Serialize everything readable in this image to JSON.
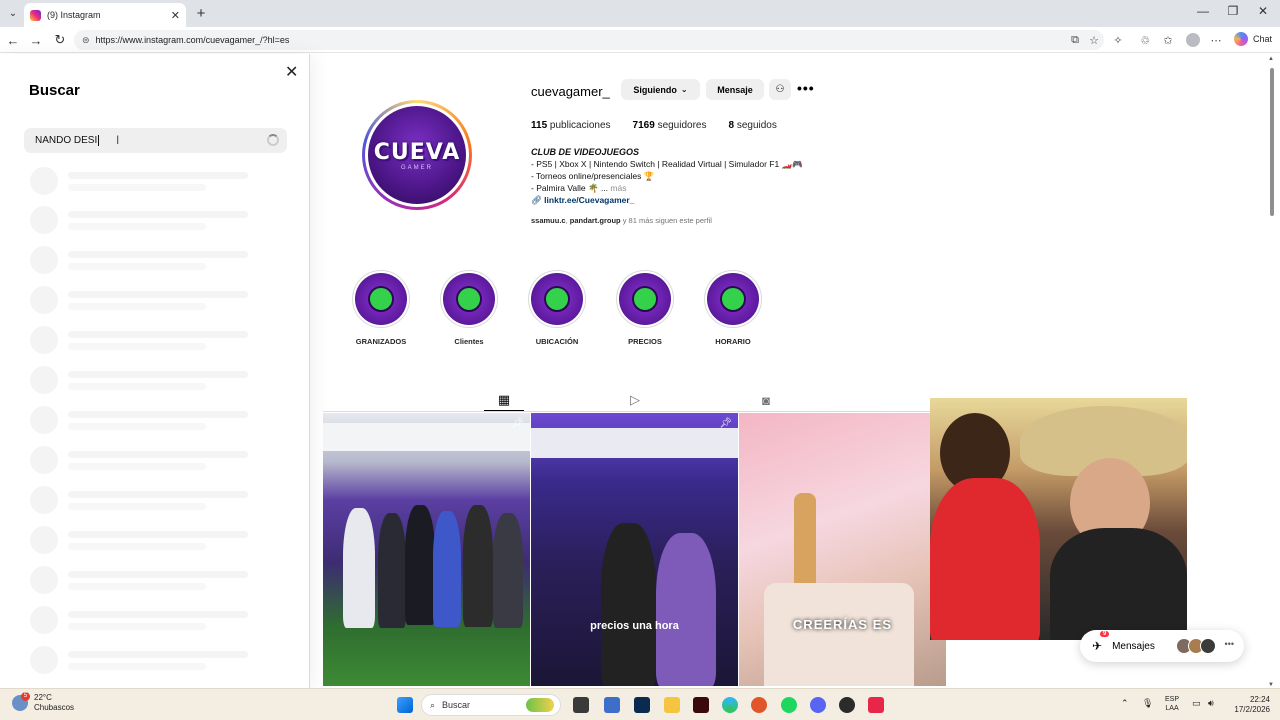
{
  "browser": {
    "tab_title": "(9) Instagram",
    "url": "https://www.instagram.com/cuevagamer_/?hl=es",
    "copilot_label": "Chat"
  },
  "search": {
    "title": "Buscar",
    "query": "NANDO DESI"
  },
  "profile": {
    "username": "cuevagamer_",
    "following_button": "Siguiendo",
    "message_button": "Mensaje",
    "stats": {
      "posts_count": "115",
      "posts_label": "publicaciones",
      "followers_count": "7169",
      "followers_label": "seguidores",
      "following_count": "8",
      "following_label": "seguidos"
    },
    "bio": {
      "name": "CLUB DE VIDEOJUEGOS",
      "line1": "- PS5 | Xbox X | Nintendo Switch | Realidad Virtual | Simulador F1 🏎️🎮",
      "line2": "- Torneos online/presenciales 🏆",
      "line3": "- Palmira Valle 🌴 ...",
      "more": "más",
      "link": "linktr.ee/Cuevagamer_"
    },
    "followed_by": {
      "user1": "ssamuu.c",
      "user2": "pandart.group",
      "rest": "y 81 más siguen este perfil"
    },
    "avatar_text": "CUEVA",
    "avatar_subtext": "GAMER"
  },
  "highlights": [
    {
      "label": "GRANIZADOS"
    },
    {
      "label": "Clientes"
    },
    {
      "label": "UBICACIÓN"
    },
    {
      "label": "PRECIOS"
    },
    {
      "label": "HORARIO"
    }
  ],
  "posts": {
    "post2_caption": "precios una hora",
    "post3_caption": "CREERÍAS ES"
  },
  "messages": {
    "label": "Mensajes",
    "badge": "9"
  },
  "taskbar": {
    "weather_temp": "22°C",
    "weather_desc": "Chubascos",
    "weather_badge": "5",
    "search_placeholder": "Buscar",
    "lang_line1": "ESP",
    "lang_line2": "LAA",
    "time": "22:24",
    "date": "17/2/2026"
  }
}
